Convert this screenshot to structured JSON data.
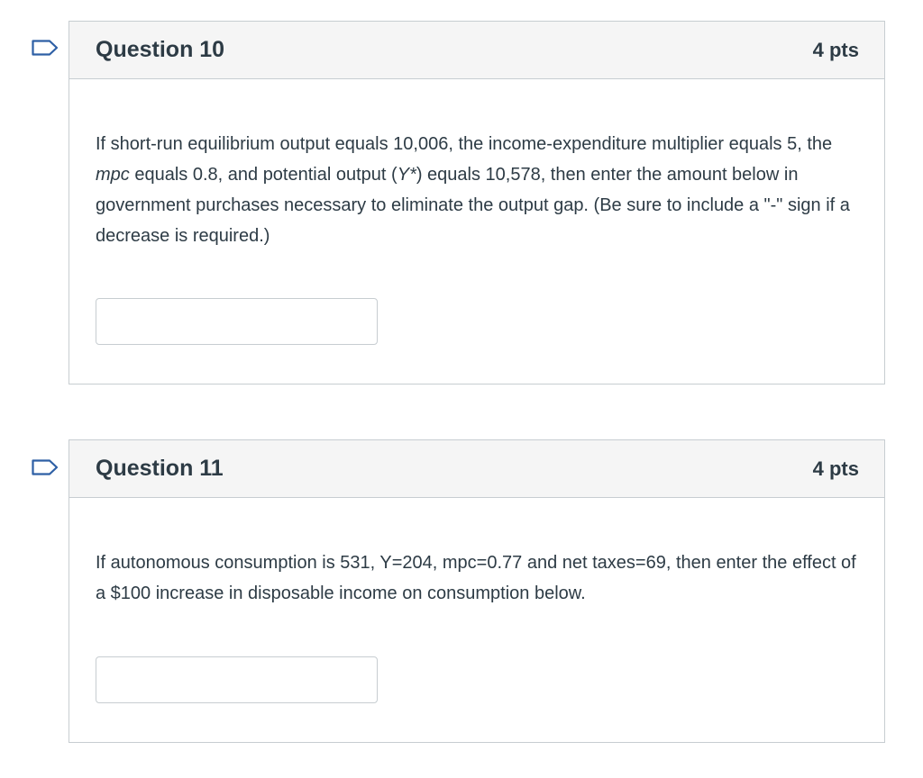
{
  "questions": [
    {
      "title": "Question 10",
      "points": "4 pts",
      "text_parts": [
        "If short-run equilibrium output equals 10,006, the income-expenditure multiplier equals 5, the ",
        "mpc",
        " equals 0.8, and potential output (",
        "Y*",
        ") equals 10,578, then enter the amount below in government purchases necessary to eliminate the output gap. (Be sure to include a \"-\" sign if a decrease is required.)"
      ],
      "answer_value": "",
      "flag_icon": "bookmark-flag-icon"
    },
    {
      "title": "Question 11",
      "points": "4 pts",
      "text": "If autonomous consumption is 531, Y=204, mpc=0.77 and net taxes=69, then enter the effect of a $100 increase in disposable income on consumption below.",
      "answer_value": "",
      "flag_icon": "bookmark-flag-icon"
    }
  ],
  "colors": {
    "flag_stroke": "#2d5fa5",
    "border": "#c7cdd1",
    "header_bg": "#f5f5f5",
    "text": "#2d3b45"
  }
}
